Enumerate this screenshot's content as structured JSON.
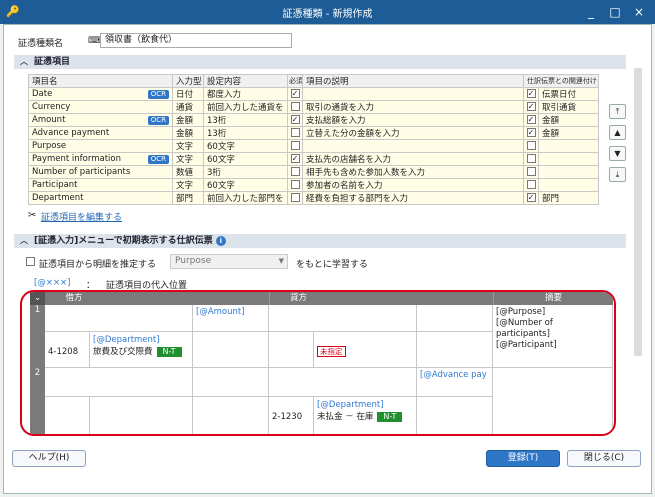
{
  "window": {
    "title": "証憑種類 - 新規作成",
    "minimize_glyph": "_",
    "restore_glyph": "□",
    "close_glyph": "×"
  },
  "form": {
    "name_label": "証憑種類名",
    "name_value": "領収書（飲食代）"
  },
  "items_section": {
    "title": "証憑項目",
    "columns": [
      "項目名",
      "入力型",
      "設定内容",
      "必須",
      "項目の説明",
      "仕訳伝票との関連付け"
    ],
    "ocr_badge": "OCR",
    "rows": [
      {
        "name": "Date",
        "ocr": true,
        "type": "日付",
        "setting": "都度入力",
        "required": true,
        "desc": "",
        "linked": true,
        "link_field": "伝票日付"
      },
      {
        "name": "Currency",
        "ocr": false,
        "type": "通貨",
        "setting": "前回入力した通貨を",
        "required": false,
        "desc": "取引の通貨を入力",
        "linked": true,
        "link_field": "取引通貨"
      },
      {
        "name": "Amount",
        "ocr": true,
        "type": "金額",
        "setting": "13桁",
        "required": true,
        "desc": "支払総額を入力",
        "linked": true,
        "link_field": "金額"
      },
      {
        "name": "Advance payment",
        "ocr": false,
        "type": "金額",
        "setting": "13桁",
        "required": false,
        "desc": "立替えた分の金額を入力",
        "linked": true,
        "link_field": "金額"
      },
      {
        "name": "Purpose",
        "ocr": false,
        "type": "文字",
        "setting": "60文字",
        "required": false,
        "desc": "",
        "linked": false,
        "link_field": ""
      },
      {
        "name": "Payment information",
        "ocr": true,
        "type": "文字",
        "setting": "60文字",
        "required": true,
        "desc": "支払先の店舗名を入力",
        "linked": false,
        "link_field": ""
      },
      {
        "name": "Number of participants",
        "ocr": false,
        "type": "数値",
        "setting": "3桁",
        "required": false,
        "desc": "相手先も含めた参加人数を入力",
        "linked": false,
        "link_field": ""
      },
      {
        "name": "Participant",
        "ocr": false,
        "type": "文字",
        "setting": "60文字",
        "required": false,
        "desc": "参加者の名前を入力",
        "linked": false,
        "link_field": ""
      },
      {
        "name": "Department",
        "ocr": false,
        "type": "部門",
        "setting": "前回入力した部門を",
        "required": false,
        "desc": "経費を負担する部門を入力",
        "linked": true,
        "link_field": "部門"
      }
    ],
    "edit_link": "証憑項目を編集する"
  },
  "journal_section": {
    "title": "[証憑入力]メニューで初期表示する仕訳伝票",
    "infer_label": "証憑項目から明細を推定する",
    "infer_dropdown": "Purpose",
    "infer_suffix": "をもとに学習する",
    "legend_placeholder": "[@×××]",
    "legend_colon": "：",
    "legend_desc": "証憑項目の代入位置",
    "headers": {
      "debit": "借方",
      "credit": "貸方",
      "summary": "摘要"
    },
    "rows": [
      {
        "num": "1",
        "debit_amount": "[@Amount]",
        "debit_dept": "[@Department]",
        "debit_code": "4-1208",
        "debit_account": "旅費及び交際費",
        "debit_tax": "N-T",
        "credit_tag": "未指定",
        "summary_lines": [
          "[@Purpose]",
          "[@Number of",
          "participants]",
          "[@Participant]"
        ]
      },
      {
        "num": "2",
        "credit_amount": "[@Advance pay",
        "credit_dept": "[@Department]",
        "credit_code": "2-1230",
        "credit_account": "未払金 － 在庫",
        "credit_tax": "N-T"
      }
    ]
  },
  "footer": {
    "help": "ヘルプ(H)",
    "register": "登録(T)",
    "close": "閉じる(C)"
  },
  "colors": {
    "titlebar": "#1d5c96",
    "accent": "#2f77c6",
    "highlight_border": "#d9001b",
    "tax_badge": "#1f8f2f"
  }
}
